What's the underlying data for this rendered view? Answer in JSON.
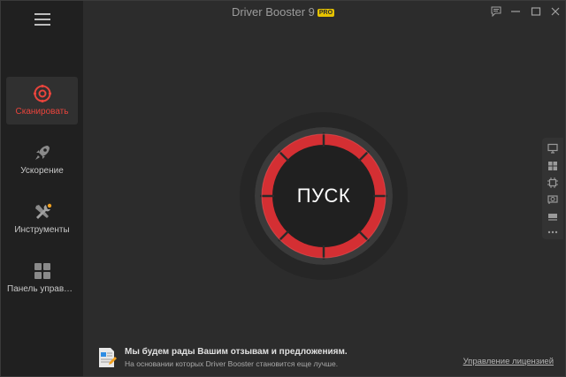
{
  "app": {
    "title": "Driver Booster 9",
    "badge": "PRO"
  },
  "titlebar": {
    "icons": [
      "feedback-icon",
      "minimize-icon",
      "maximize-icon",
      "close-icon"
    ]
  },
  "sidebar": {
    "menu_icon": "hamburger-icon",
    "items": [
      {
        "label": "Сканировать",
        "icon": "scan-icon",
        "active": true
      },
      {
        "label": "Ускорение",
        "icon": "rocket-icon",
        "active": false
      },
      {
        "label": "Инструменты",
        "icon": "tools-icon",
        "active": false
      },
      {
        "label": "Панель управления",
        "icon": "grid-icon",
        "active": false
      }
    ]
  },
  "main": {
    "scan_button_label": "ПУСК"
  },
  "side_tools": [
    "monitor-icon",
    "windows-icon",
    "chip-icon",
    "gpu-icon",
    "network-card-icon",
    "more-icon"
  ],
  "footer": {
    "feedback_title": "Мы будем рады Вашим отзывам и предложениям.",
    "feedback_subtitle": "На основании которых Driver Booster становится еще лучше.",
    "license_link": "Управление лицензией"
  },
  "colors": {
    "accent": "#e8443c",
    "ring": "#d42f33",
    "sidebar_bg": "#202020",
    "main_bg": "#2c2c2c",
    "badge": "#e6c300"
  }
}
